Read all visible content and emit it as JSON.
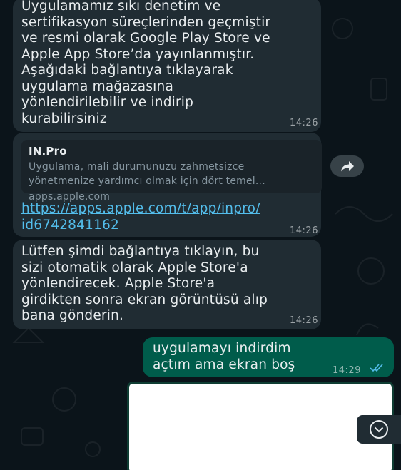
{
  "messages": [
    {
      "direction": "incoming",
      "text": "Uygulamamız sıkı denetim ve\nsertifikasyon süreçlerinden geçmiştir\nve resmi olarak Google Play Store ve\nApple App Store’da yayınlanmıştır.\nAşağıdaki bağlantıya tıklayarak\nuygulama mağazasına\nyönlendirilebilir ve indirip\nkurabilirsiniz",
      "time": "14:26"
    },
    {
      "direction": "incoming",
      "preview": {
        "title": "IN.Pro",
        "description": "Uygulama, mali durumunuzu zahmetsizce\nyönetmenize yardımcı olmak için dört temel...",
        "domain": "apps.apple.com"
      },
      "link": "https://apps.apple.com/t/app/inpro/\nid6742841162",
      "time": "14:26"
    },
    {
      "direction": "incoming",
      "text": "Lütfen şimdi bağlantıya tıklayın, bu\nsizi otomatik olarak Apple Store'a\nyönlendirecek. Apple Store'a\ngirdikten sonra ekran görüntüsü alıp\nbana gönderin.",
      "time": "14:26"
    },
    {
      "direction": "outgoing",
      "text": "uygulamayı indirdim\naçtım ama ekran boş",
      "time": "14:29",
      "status": "read"
    }
  ],
  "icons": {
    "forward": "forward-arrow-icon",
    "scroll_down": "chevron-down-icon",
    "read_receipt": "double-check-icon"
  },
  "colors": {
    "background": "#0b141a",
    "incoming_bubble": "#202c33",
    "outgoing_bubble": "#005c4b",
    "link": "#53bdeb",
    "read_check": "#53bdeb"
  }
}
